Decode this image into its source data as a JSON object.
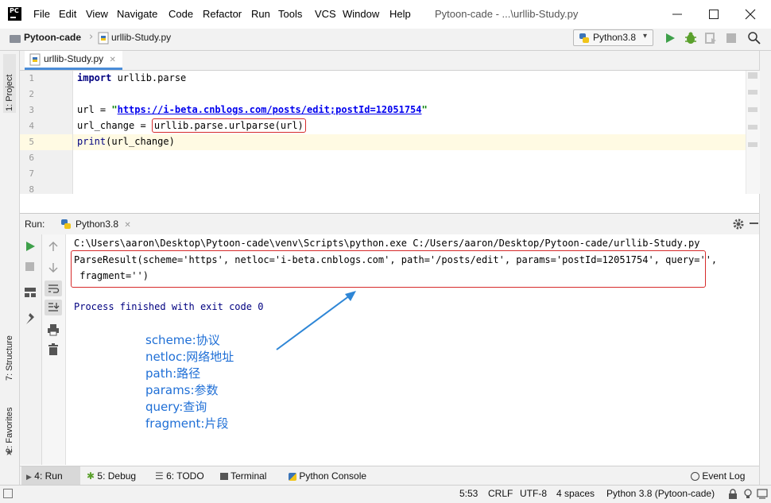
{
  "app": {
    "icon_text": "PC",
    "window_title": "Pytoon-cade - ...\\urllib-Study.py"
  },
  "menu": {
    "file": "File",
    "edit": "Edit",
    "view": "View",
    "navigate": "Navigate",
    "code": "Code",
    "refactor": "Refactor",
    "run": "Run",
    "tools": "Tools",
    "vcs": "VCS",
    "window": "Window",
    "help": "Help"
  },
  "nav": {
    "project": "Pytoon-cade",
    "file": "urllib-Study.py",
    "interpreter": "Python3.8"
  },
  "side": {
    "project": "1: Project",
    "structure": "7: Structure",
    "favorites": "2: Favorites"
  },
  "editor": {
    "tab": "urllib-Study.py",
    "line_numbers": [
      "1",
      "2",
      "3",
      "4",
      "5",
      "6",
      "7",
      "8"
    ],
    "l1_kw": "import",
    "l1_rest": " urllib.parse",
    "l3_a": "url = ",
    "l3_q1": "\"",
    "l3_url": "https://i-beta.cnblogs.com/posts/edit;postId=12051754",
    "l3_q2": "\"",
    "l4_a": "url_change = ",
    "l4_box": "urllib.parse.urlparse(url)",
    "l5_fn": "print",
    "l5_rest": "(url_change)"
  },
  "run": {
    "label": "Run:",
    "tab": "Python3.8",
    "cmd": "C:\\Users\\aaron\\Desktop\\Pytoon-cade\\venv\\Scripts\\python.exe C:/Users/aaron/Desktop/Pytoon-cade/urllib-Study.py",
    "result1": "ParseResult(scheme='https', netloc='i-beta.cnblogs.com', path='/posts/edit', params='postId=12051754', query='',",
    "result2": " fragment='')",
    "finished": "Process finished with exit code 0"
  },
  "notes": [
    "scheme:协议",
    "netloc:网络地址",
    "path:路径",
    "params:参数",
    "query:查询",
    "fragment:片段"
  ],
  "tools": {
    "run": "4: Run",
    "debug": "5: Debug",
    "todo": "6: TODO",
    "terminal": "Terminal",
    "console": "Python Console",
    "event_log": "Event Log"
  },
  "status": {
    "position": "5:53",
    "line_sep": "CRLF",
    "encoding": "UTF-8",
    "indent": "4 spaces",
    "interpreter": "Python 3.8 (Pytoon-cade)"
  },
  "colors": {
    "keyword": "#000080",
    "string": "#008000",
    "note_blue": "#1f6fd6",
    "highlight_red": "#d62b2b",
    "run_green": "#3ea04a",
    "console_blue": "#000080"
  }
}
